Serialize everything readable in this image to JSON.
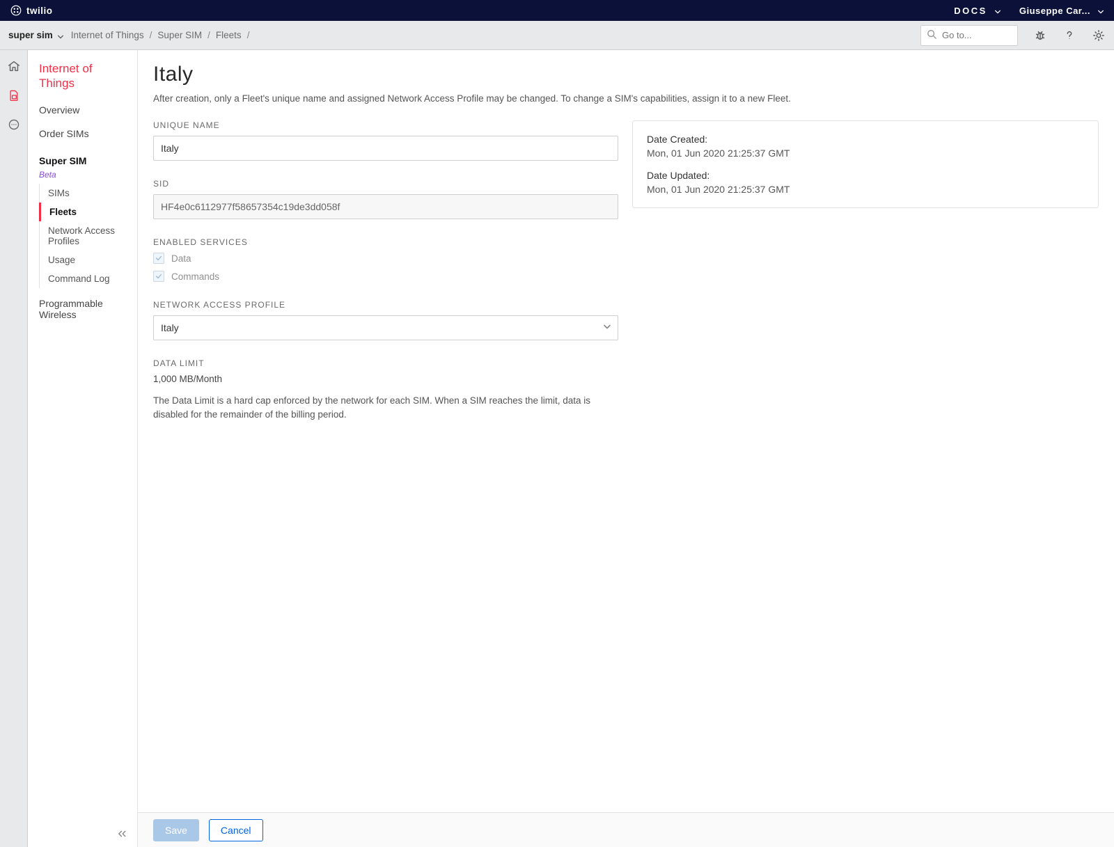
{
  "brand": "twilio",
  "topnav": {
    "docs": "DOCS",
    "user": "Giuseppe Car..."
  },
  "subbar": {
    "project": "super sim",
    "crumbs": [
      "Internet of Things",
      "Super SIM",
      "Fleets"
    ],
    "search_placeholder": "Go to..."
  },
  "sidebar": {
    "title": "Internet of Things",
    "items": [
      {
        "label": "Overview"
      },
      {
        "label": "Order SIMs"
      },
      {
        "label": "Super SIM",
        "section": true,
        "beta": "Beta",
        "children": [
          {
            "label": "SIMs"
          },
          {
            "label": "Fleets",
            "active": true
          },
          {
            "label": "Network Access Profiles"
          },
          {
            "label": "Usage"
          },
          {
            "label": "Command Log"
          }
        ]
      },
      {
        "label": "Programmable Wireless"
      }
    ]
  },
  "page": {
    "title": "Italy",
    "description": "After creation, only a Fleet's unique name and assigned Network Access Profile may be changed. To change a SIM's capabilities, assign it to a new Fleet.",
    "unique_name_label": "UNIQUE NAME",
    "unique_name_value": "Italy",
    "sid_label": "SID",
    "sid_value": "HF4e0c6112977f58657354c19de3dd058f",
    "enabled_services_label": "ENABLED SERVICES",
    "service_data": "Data",
    "service_commands": "Commands",
    "nap_label": "NETWORK ACCESS PROFILE",
    "nap_value": "Italy",
    "data_limit_label": "DATA LIMIT",
    "data_limit_value": "1,000 MB/Month",
    "data_limit_help": "The Data Limit is a hard cap enforced by the network for each SIM. When a SIM reaches the limit, data is disabled for the remainder of the billing period."
  },
  "info": {
    "created_label": "Date Created:",
    "created_value": "Mon, 01 Jun 2020 21:25:37 GMT",
    "updated_label": "Date Updated:",
    "updated_value": "Mon, 01 Jun 2020 21:25:37 GMT"
  },
  "footer": {
    "save": "Save",
    "cancel": "Cancel"
  }
}
